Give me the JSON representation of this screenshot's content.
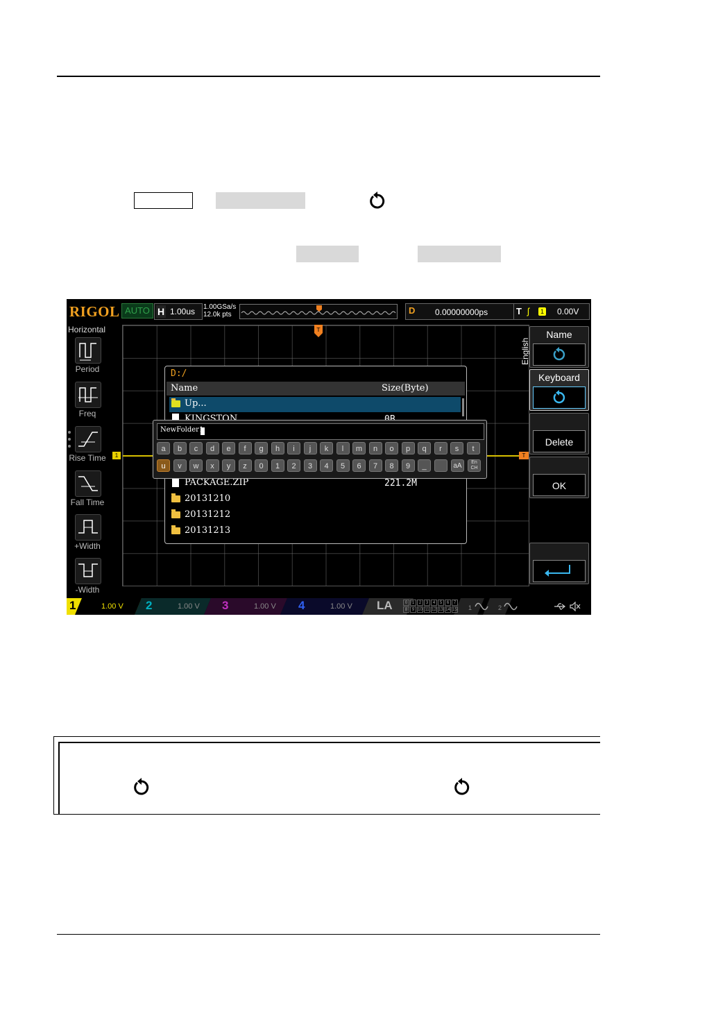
{
  "scope": {
    "brand": "RIGOL",
    "run_mode": "AUTO",
    "horizontal": {
      "label": "H",
      "timebase": "1.00us"
    },
    "sample_rate": "1.00GSa/s",
    "memory_depth": "12.0k pts",
    "delay": {
      "label": "D",
      "value": "0.00000000ps"
    },
    "trigger": {
      "label": "T",
      "edge": "ʃ",
      "source": "1",
      "level": "0.00V"
    },
    "left_menu": {
      "title": "Horizontal",
      "items": [
        {
          "label": "Period",
          "icon": "period-icon"
        },
        {
          "label": "Freq",
          "icon": "freq-icon"
        },
        {
          "label": "Rise Time",
          "icon": "rise-time-icon"
        },
        {
          "label": "Fall Time",
          "icon": "fall-time-icon"
        },
        {
          "label": "+Width",
          "icon": "positive-width-icon"
        },
        {
          "label": "-Width",
          "icon": "negative-width-icon"
        }
      ]
    },
    "markers": {
      "channel": "1",
      "trigger": "T",
      "trigger_position": "T"
    },
    "file_dialog": {
      "path": "D:/",
      "col_name": "Name",
      "col_size": "Size(Byte)",
      "rows": [
        {
          "name": "Up...",
          "size": "",
          "icon": "up-folder-icon"
        },
        {
          "name": "KINGSTON",
          "size": "0B",
          "icon": "file-icon"
        },
        {
          "name": "PACKAGE.ZIP",
          "size": "221.2M",
          "icon": "file-icon"
        },
        {
          "name": "20131210",
          "size": "",
          "icon": "folder-icon"
        },
        {
          "name": "20131212",
          "size": "",
          "icon": "folder-icon"
        },
        {
          "name": "20131213",
          "size": "",
          "icon": "folder-icon"
        }
      ]
    },
    "keyboard": {
      "input_value": "NewFolder1",
      "row1": [
        "a",
        "b",
        "c",
        "d",
        "e",
        "f",
        "g",
        "h",
        "i",
        "j",
        "k",
        "l",
        "m",
        "n",
        "o",
        "p",
        "q",
        "r",
        "s",
        "t"
      ],
      "row2": [
        "u",
        "v",
        "w",
        "x",
        "y",
        "z",
        "0",
        "1",
        "2",
        "3",
        "4",
        "5",
        "6",
        "7",
        "8",
        "9",
        "_",
        ""
      ],
      "case_key": "aA",
      "lang_key": "En CH"
    },
    "right_menu": {
      "language": "English",
      "name": "Name",
      "keyboard": "Keyboard",
      "delete": "Delete",
      "ok": "OK"
    },
    "channels": [
      {
        "num": "1",
        "volts": "1.00 V",
        "color": "#f0e000"
      },
      {
        "num": "2",
        "volts": "1.00 V",
        "color": "#00b0c0"
      },
      {
        "num": "3",
        "volts": "1.00 V",
        "color": "#c030c0"
      },
      {
        "num": "4",
        "volts": "1.00 V",
        "color": "#3060f0"
      }
    ],
    "la": "LA",
    "la_bits": [
      "0",
      "1",
      "2",
      "3",
      "4",
      "5",
      "6",
      "7",
      "8",
      "9",
      "10",
      "11",
      "12",
      "13",
      "14",
      "15"
    ],
    "gen_labels": [
      "1",
      "2"
    ]
  }
}
